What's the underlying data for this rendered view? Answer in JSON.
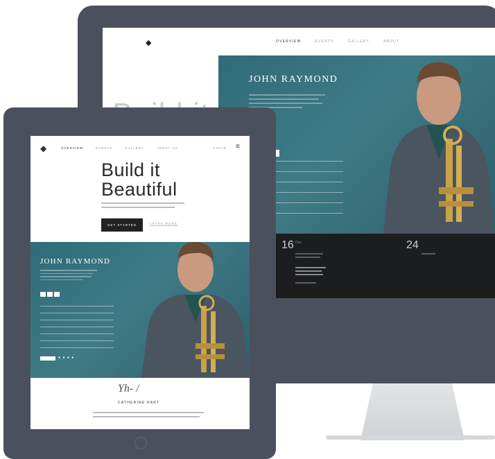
{
  "desktop": {
    "nav": {
      "items": [
        "OVERVIEW",
        "EVENTS",
        "GALLERY",
        "ABOUT"
      ]
    },
    "hero_background_text": "Build it",
    "artist": {
      "name": "JOHN RAYMOND"
    },
    "events": [
      {
        "day": "16",
        "month": "Dec"
      },
      {
        "day": "24",
        "month": ""
      }
    ]
  },
  "tablet": {
    "nav": {
      "items": [
        "OVERVIEW",
        "EVENTS",
        "GALLERY",
        "ABOUT US"
      ],
      "login": "LOGIN"
    },
    "hero": {
      "title_line1": "Build it",
      "title_line2": "Beautiful",
      "primary_button": "GET STARTED",
      "secondary_button": "LEARN MORE"
    },
    "artist": {
      "name": "JOHN RAYMOND"
    },
    "testimonial": {
      "signature": "Yh-  /",
      "caption": "CATHERINE HART"
    }
  },
  "icons": {
    "logo": "hexagon-logo-icon",
    "menu": "hamburger-menu-icon",
    "social": [
      "facebook-icon",
      "twitter-icon",
      "instagram-icon",
      "youtube-icon"
    ],
    "player_controls": [
      "prev-icon",
      "play-icon",
      "next-icon"
    ]
  },
  "colors": {
    "device_frame": "#4b515c",
    "teal_panel": "#3a7480",
    "dark_panel": "#1c1d1f",
    "button_dark": "#222222"
  }
}
